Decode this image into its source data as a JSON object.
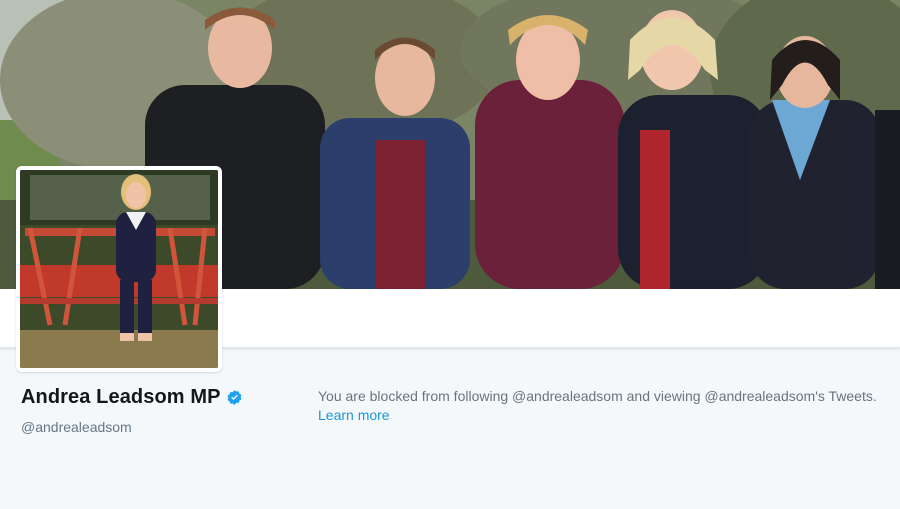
{
  "profile": {
    "display_name": "Andrea Leadsom MP",
    "handle": "@andrealeadsom",
    "verified": true,
    "verified_icon": "verified-badge-icon"
  },
  "notice": {
    "blocked_text": "You are blocked from following @andrealeadsom and viewing @andrealeadsom's Tweets.",
    "learn_more_label": "Learn more"
  },
  "colors": {
    "link": "#1b95e0",
    "verified_badge": "#1da1f2",
    "page_background": "#f5f8fa",
    "secondary_text": "#657786"
  }
}
